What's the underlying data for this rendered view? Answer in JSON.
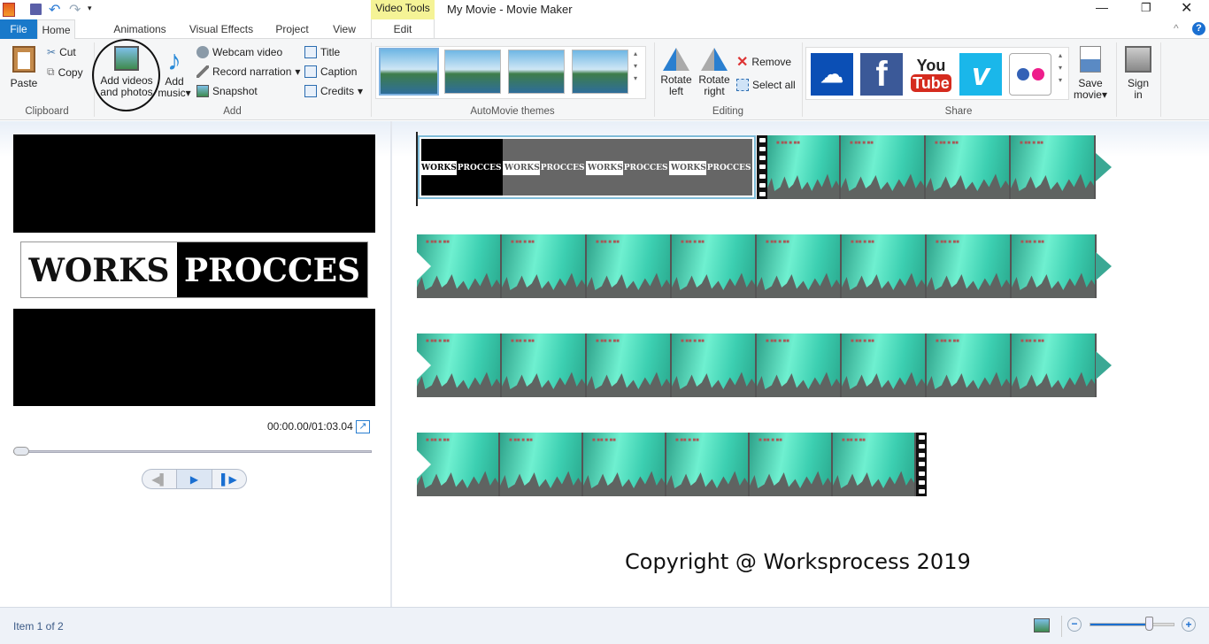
{
  "window": {
    "title": "My Movie - Movie Maker",
    "contextual_tab_group": "Video Tools"
  },
  "tabs": [
    {
      "label": "File"
    },
    {
      "label": "Home"
    },
    {
      "label": "Animations"
    },
    {
      "label": "Visual Effects"
    },
    {
      "label": "Project"
    },
    {
      "label": "View"
    },
    {
      "label": "Edit"
    }
  ],
  "ribbon": {
    "clipboard": {
      "label": "Clipboard",
      "paste": "Paste",
      "cut": "Cut",
      "copy": "Copy"
    },
    "add": {
      "label": "Add",
      "add_videos": "Add videos",
      "add_videos2": "and photos",
      "add_music": "Add",
      "add_music2": "music",
      "webcam": "Webcam video",
      "narration": "Record narration",
      "snapshot": "Snapshot",
      "title": "Title",
      "caption": "Caption",
      "credits": "Credits"
    },
    "themes": {
      "label": "AutoMovie themes"
    },
    "editing": {
      "label": "Editing",
      "rotate_left": "Rotate",
      "rotate_left2": "left",
      "rotate_right": "Rotate",
      "rotate_right2": "right",
      "remove": "Remove",
      "select_all": "Select all"
    },
    "share": {
      "label": "Share",
      "services": [
        "OneDrive",
        "Facebook",
        "YouTube",
        "Vimeo",
        "Flickr"
      ],
      "youtube_top": "You",
      "youtube_bottom": "Tube",
      "facebook_letter": "f",
      "vimeo_letter": "v",
      "save_movie": "Save",
      "save_movie2": "movie"
    },
    "sign_in": {
      "line1": "Sign",
      "line2": "in"
    }
  },
  "preview": {
    "logo_left": "WORKS",
    "logo_right": "PROCCES",
    "time": "00:00.00/01:03.04",
    "seek_fraction": 0
  },
  "timeline": {
    "clip_title_left": "WORKS",
    "clip_title_right": "PROCCES"
  },
  "watermark": "Copyright @ Worksprocess 2019",
  "status": {
    "item": "Item 1 of 2",
    "zoom_fraction": 0.7
  },
  "colors": {
    "file_tab": "#1979ca",
    "video_tools": "#f5f396",
    "accent": "#2b7cd3"
  }
}
